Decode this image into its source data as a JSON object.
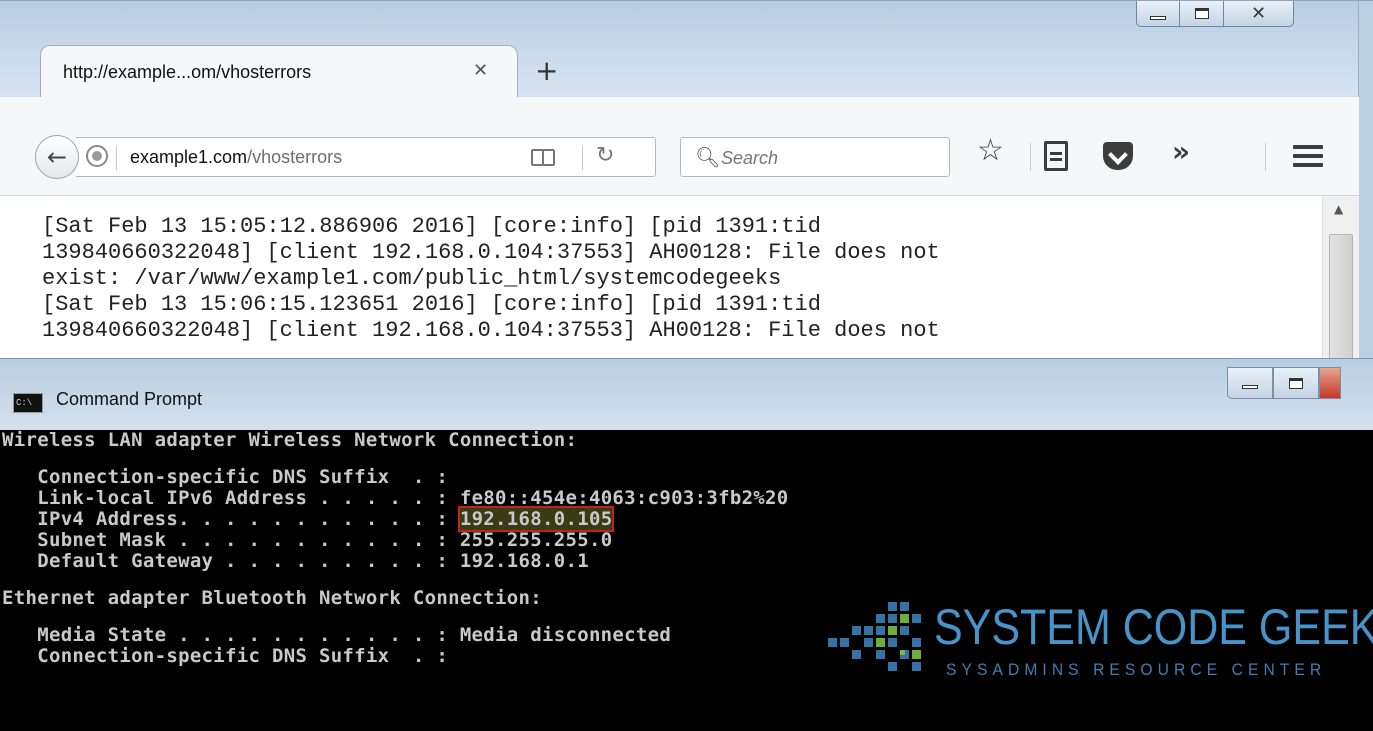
{
  "browser": {
    "tab_title": "http://example...om/vhosterrors",
    "tab_close": "✕",
    "new_tab": "+",
    "back_icon": "back-arrow-icon",
    "url_domain": "example1.com",
    "url_path": "/vhosterrors",
    "search_placeholder": "Search",
    "overflow_label": "»",
    "log_lines": [
      "[Sat Feb 13 15:05:12.886906 2016] [core:info] [pid 1391:tid",
      "139840660322048] [client 192.168.0.104:37553] AH00128: File does not",
      "exist: /var/www/example1.com/public_html/systemcodegeeks",
      "[Sat Feb 13 15:06:15.123651 2016] [core:info] [pid 1391:tid",
      "139840660322048] [client 192.168.0.104:37553] AH00128: File does not"
    ]
  },
  "cmd": {
    "title": "Command Prompt",
    "icon_text": "C:\\",
    "lines": {
      "wlan_header": "Wireless LAN adapter Wireless Network Connection:",
      "dns_suffix": "   Connection-specific DNS Suffix  . :",
      "ipv6_label": "   Link-local IPv6 Address . . . . . : ",
      "ipv6_value": "fe80::454e:4063:c903:3fb2%20",
      "ipv4_label": "   IPv4 Address. . . . . . . . . . . : ",
      "ipv4_value": "192.168.0.105",
      "subnet_label": "   Subnet Mask . . . . . . . . . . . : ",
      "subnet_value": "255.255.255.0",
      "gateway_label": "   Default Gateway . . . . . . . . . : ",
      "gateway_value": "192.168.0.1",
      "bt_header": "Ethernet adapter Bluetooth Network Connection:",
      "media_state": "   Media State . . . . . . . . . . . : Media disconnected",
      "dns_suffix2": "   Connection-specific DNS Suffix  . :"
    }
  },
  "watermark": {
    "title": "SYSTEM CODE GEEKS",
    "subtitle": "SYSADMINS RESOURCE CENTER"
  }
}
